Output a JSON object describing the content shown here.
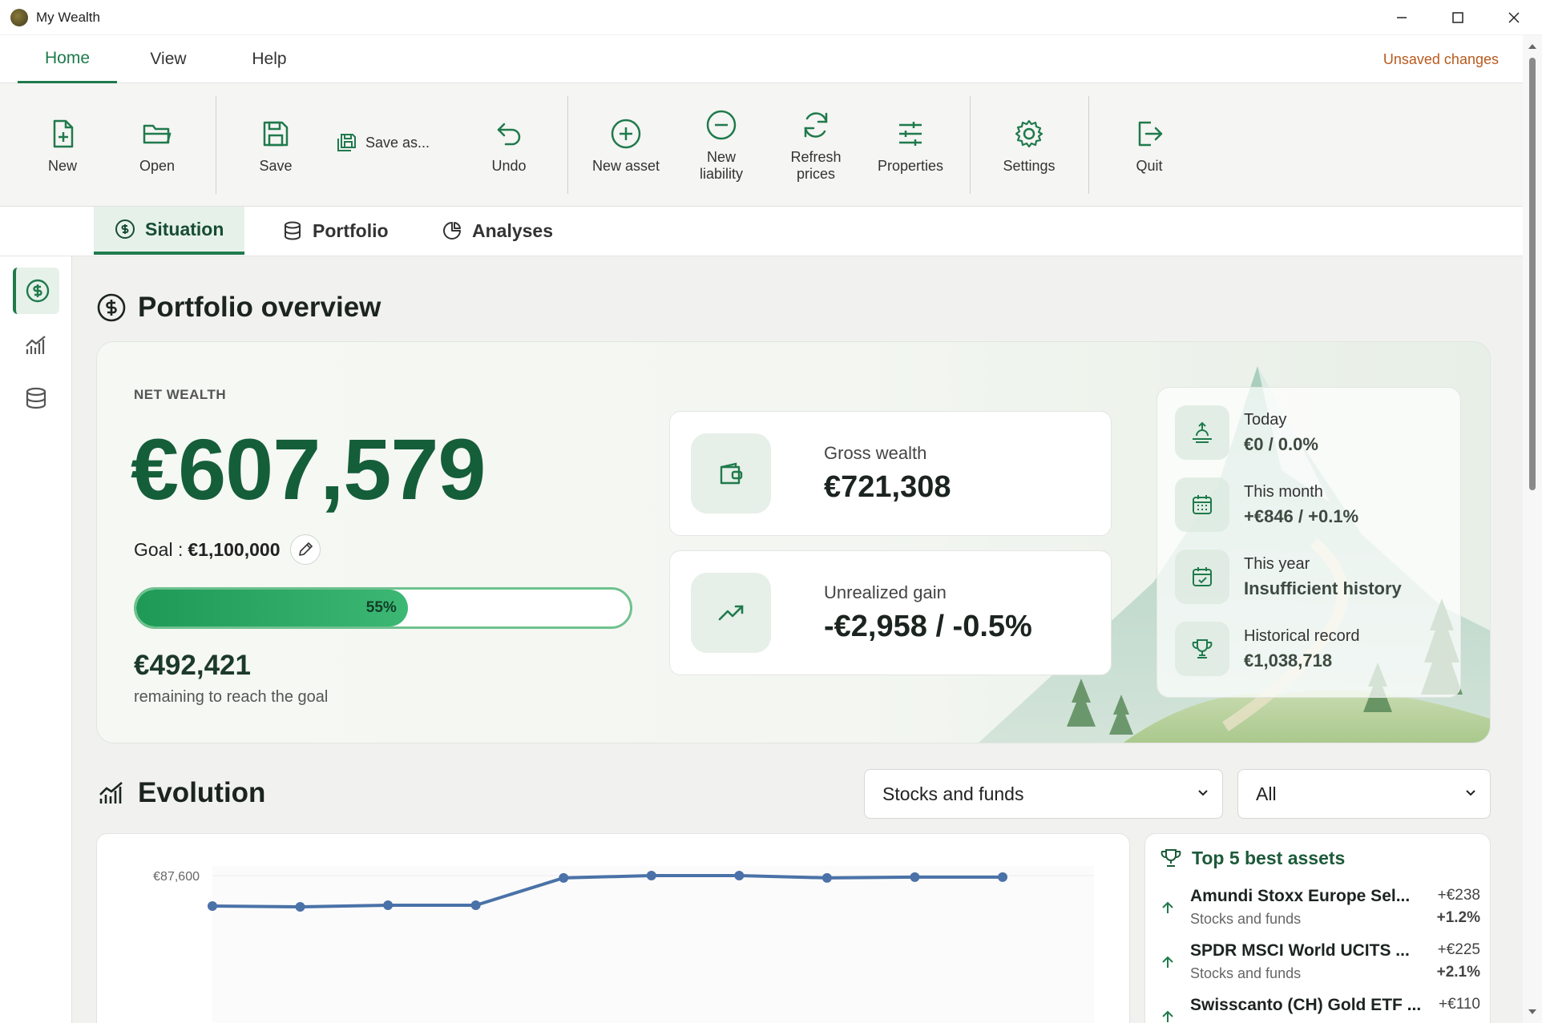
{
  "window": {
    "title": "My Wealth"
  },
  "menu": {
    "tabs": [
      "Home",
      "View",
      "Help"
    ],
    "unsaved": "Unsaved changes"
  },
  "toolbar": {
    "new": "New",
    "open": "Open",
    "save": "Save",
    "save_as": "Save as...",
    "undo": "Undo",
    "new_asset": "New asset",
    "new_liability": "New liability",
    "refresh_prices": "Refresh prices",
    "properties": "Properties",
    "settings": "Settings",
    "quit": "Quit"
  },
  "page_tabs": [
    "Situation",
    "Portfolio",
    "Analyses"
  ],
  "overview": {
    "title": "Portfolio overview",
    "net_wealth_label": "NET WEALTH",
    "net_wealth_value": "€607,579",
    "goal_label": "Goal :",
    "goal_value": "€1,100,000",
    "progress": 0.55,
    "progress_text": "55%",
    "remaining_value": "€492,421",
    "remaining_label": "remaining to reach the goal",
    "gross_label": "Gross wealth",
    "gross_value": "€721,308",
    "unrealized_label": "Unrealized gain",
    "unrealized_value": "-€2,958 / -0.5%",
    "periods": [
      {
        "label": "Today",
        "value": "€0 / 0.0%"
      },
      {
        "label": "This month",
        "value": "+€846 / +0.1%"
      },
      {
        "label": "This year",
        "value": "Insufficient history"
      },
      {
        "label": "Historical record",
        "value": "€1,038,718"
      }
    ]
  },
  "evolution": {
    "title": "Evolution",
    "filter_category": "Stocks and funds",
    "filter_period": "All"
  },
  "chart_data": {
    "type": "line",
    "ytick_labels": [
      "€87,600"
    ],
    "series": [
      {
        "values": [
          87200,
          87190,
          87210,
          87210,
          87570,
          87600,
          87600,
          87570,
          87580,
          87580
        ]
      }
    ],
    "color": "#4a72a8"
  },
  "top_assets": {
    "title": "Top 5 best assets",
    "items": [
      {
        "name": "Amundi Stoxx Europe Sel...",
        "category": "Stocks and funds",
        "gain": "+€238",
        "pct": "+1.2%"
      },
      {
        "name": "SPDR MSCI World UCITS ...",
        "category": "Stocks and funds",
        "gain": "+€225",
        "pct": "+2.1%"
      },
      {
        "name": "Swisscanto (CH) Gold ETF ...",
        "gain": "+€110"
      }
    ]
  },
  "colors": {
    "accent": "#1f7a4c",
    "dark_green": "#155e3a",
    "unsaved": "#b85a1e"
  }
}
